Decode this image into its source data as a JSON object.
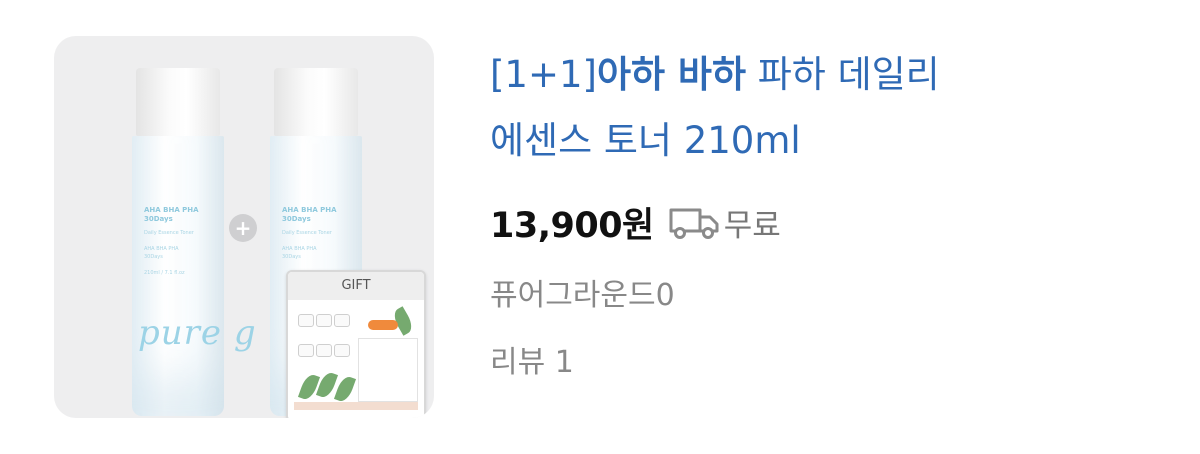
{
  "product": {
    "title_prefix": "[1+1]",
    "title_brand": "아하 바하",
    "title_line1_rest": " 파하 데일리",
    "title_line2": "에센스 토너 210ml",
    "price": "13,900원",
    "shipping": "무료",
    "seller": "퓨어그라운드0",
    "review": "리뷰 1"
  },
  "image": {
    "bottle_label_line1": "AHA BHA PHA",
    "bottle_label_line2": "30Days",
    "bottle_brand": "pure g",
    "gift_label": "GIFT"
  },
  "icons": {
    "shipping": "truck-icon",
    "plus": "plus-icon"
  },
  "colors": {
    "title": "#2f6ab5",
    "price": "#111111",
    "muted": "#888888"
  }
}
